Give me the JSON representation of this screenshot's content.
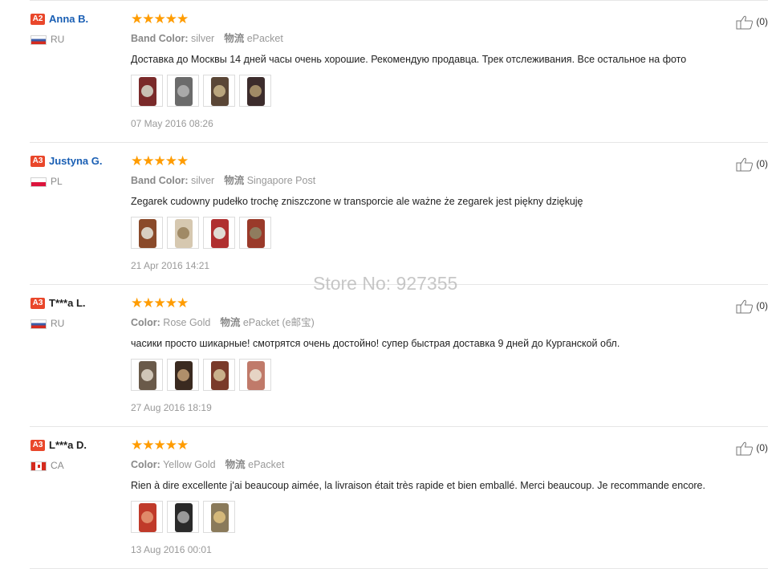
{
  "colors": {
    "star": "#ff9c00",
    "level_badge": "#e9472b",
    "username_link": "#1a5fb4",
    "meta_text": "#999999"
  },
  "watermark": "Store No: 927355",
  "reviews": [
    {
      "level": "A2",
      "name": "Anna B.",
      "name_style": "link",
      "flag": "ru",
      "country": "RU",
      "stars": "★★★★★",
      "attr1_label": "Band Color:",
      "attr1_value": "silver",
      "attr2_label": "物流",
      "attr2_value": "ePacket",
      "text": "Доставка до Москвы 14 дней часы очень хорошие. Рекомендую продавца. Трек отслеживания. Все остальное на фото",
      "thumbs": [
        {
          "c1": "#7a2a2a",
          "c2": "#c9c0b4"
        },
        {
          "c1": "#6b6b6b",
          "c2": "#a9a9a9"
        },
        {
          "c1": "#5a4636",
          "c2": "#b9a57d"
        },
        {
          "c1": "#3c2c2c",
          "c2": "#a08a66"
        }
      ],
      "date": "07 May 2016 08:26",
      "likes": "(0)"
    },
    {
      "level": "A3",
      "name": "Justyna G.",
      "name_style": "link",
      "flag": "pl",
      "country": "PL",
      "stars": "★★★★★",
      "attr1_label": "Band Color:",
      "attr1_value": "silver",
      "attr2_label": "物流",
      "attr2_value": "Singapore Post",
      "text": "Zegarek cudowny pudełko trochę zniszczone w transporcie ale ważne że zegarek jest piękny dziękuję",
      "thumbs": [
        {
          "c1": "#8a4a2a",
          "c2": "#d8cfc2"
        },
        {
          "c1": "#d6c8b0",
          "c2": "#a08a66"
        },
        {
          "c1": "#b03030",
          "c2": "#e0dcd4"
        },
        {
          "c1": "#9a3a2a",
          "c2": "#8f7c5e"
        }
      ],
      "date": "21 Apr 2016 14:21",
      "likes": "(0)"
    },
    {
      "level": "A3",
      "name": "T***a L.",
      "name_style": "anon",
      "flag": "ru",
      "country": "RU",
      "stars": "★★★★★",
      "attr1_label": "Color:",
      "attr1_value": "Rose Gold",
      "attr2_label": "物流",
      "attr2_value": "ePacket (e邮宝)",
      "text": "часики просто шикарные! смотрятся очень достойно! супер быстрая доставка 9 дней до Курганской обл.",
      "thumbs": [
        {
          "c1": "#6a5a4a",
          "c2": "#d0c6b8"
        },
        {
          "c1": "#3a2a20",
          "c2": "#b08f6a"
        },
        {
          "c1": "#7a3a2a",
          "c2": "#c9b08a"
        },
        {
          "c1": "#c07a6a",
          "c2": "#e6d4c4"
        }
      ],
      "date": "27 Aug 2016 18:19",
      "likes": "(0)"
    },
    {
      "level": "A3",
      "name": "L***a D.",
      "name_style": "anon",
      "flag": "ca",
      "country": "CA",
      "stars": "★★★★★",
      "attr1_label": "Color:",
      "attr1_value": "Yellow Gold",
      "attr2_label": "物流",
      "attr2_value": "ePacket",
      "text": "Rien à dire excellente j'ai beaucoup aimée, la livraison était très rapide et bien emballé. Merci beaucoup. Je recommande encore.",
      "thumbs": [
        {
          "c1": "#c03a2a",
          "c2": "#e08a6a"
        },
        {
          "c1": "#2a2a2a",
          "c2": "#9a9a9a"
        },
        {
          "c1": "#8a7a5a",
          "c2": "#d4b87a"
        }
      ],
      "date": "13 Aug 2016 00:01",
      "likes": "(0)"
    }
  ]
}
